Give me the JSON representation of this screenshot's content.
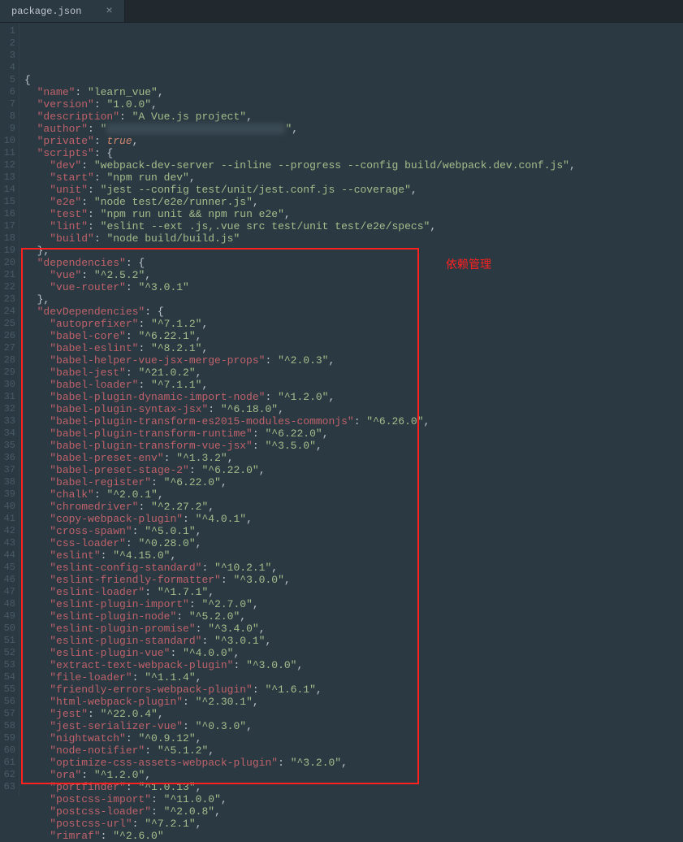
{
  "tab": {
    "title": "package.json",
    "close": "×"
  },
  "annotation": "依赖管理",
  "json": {
    "header": [
      {
        "key": "name",
        "val": "learn_vue"
      },
      {
        "key": "version",
        "val": "1.0.0"
      },
      {
        "key": "description",
        "val": "A Vue.js project"
      }
    ],
    "author_key": "author",
    "private_key": "private",
    "private_val": "true",
    "scripts_key": "scripts",
    "scripts": [
      {
        "key": "dev",
        "val": "webpack-dev-server --inline --progress --config build/webpack.dev.conf.js"
      },
      {
        "key": "start",
        "val": "npm run dev"
      },
      {
        "key": "unit",
        "val": "jest --config test/unit/jest.conf.js --coverage"
      },
      {
        "key": "e2e",
        "val": "node test/e2e/runner.js"
      },
      {
        "key": "test",
        "val": "npm run unit && npm run e2e"
      },
      {
        "key": "lint",
        "val": "eslint --ext .js,.vue src test/unit test/e2e/specs"
      },
      {
        "key": "build",
        "val": "node build/build.js"
      }
    ],
    "dependencies_key": "dependencies",
    "dependencies": [
      {
        "key": "vue",
        "val": "^2.5.2"
      },
      {
        "key": "vue-router",
        "val": "^3.0.1"
      }
    ],
    "devDependencies_key": "devDependencies",
    "devDependencies": [
      {
        "key": "autoprefixer",
        "val": "^7.1.2"
      },
      {
        "key": "babel-core",
        "val": "^6.22.1"
      },
      {
        "key": "babel-eslint",
        "val": "^8.2.1"
      },
      {
        "key": "babel-helper-vue-jsx-merge-props",
        "val": "^2.0.3"
      },
      {
        "key": "babel-jest",
        "val": "^21.0.2"
      },
      {
        "key": "babel-loader",
        "val": "^7.1.1"
      },
      {
        "key": "babel-plugin-dynamic-import-node",
        "val": "^1.2.0"
      },
      {
        "key": "babel-plugin-syntax-jsx",
        "val": "^6.18.0"
      },
      {
        "key": "babel-plugin-transform-es2015-modules-commonjs",
        "val": "^6.26.0"
      },
      {
        "key": "babel-plugin-transform-runtime",
        "val": "^6.22.0"
      },
      {
        "key": "babel-plugin-transform-vue-jsx",
        "val": "^3.5.0"
      },
      {
        "key": "babel-preset-env",
        "val": "^1.3.2"
      },
      {
        "key": "babel-preset-stage-2",
        "val": "^6.22.0"
      },
      {
        "key": "babel-register",
        "val": "^6.22.0"
      },
      {
        "key": "chalk",
        "val": "^2.0.1"
      },
      {
        "key": "chromedriver",
        "val": "^2.27.2"
      },
      {
        "key": "copy-webpack-plugin",
        "val": "^4.0.1"
      },
      {
        "key": "cross-spawn",
        "val": "^5.0.1"
      },
      {
        "key": "css-loader",
        "val": "^0.28.0"
      },
      {
        "key": "eslint",
        "val": "^4.15.0"
      },
      {
        "key": "eslint-config-standard",
        "val": "^10.2.1"
      },
      {
        "key": "eslint-friendly-formatter",
        "val": "^3.0.0"
      },
      {
        "key": "eslint-loader",
        "val": "^1.7.1"
      },
      {
        "key": "eslint-plugin-import",
        "val": "^2.7.0"
      },
      {
        "key": "eslint-plugin-node",
        "val": "^5.2.0"
      },
      {
        "key": "eslint-plugin-promise",
        "val": "^3.4.0"
      },
      {
        "key": "eslint-plugin-standard",
        "val": "^3.0.1"
      },
      {
        "key": "eslint-plugin-vue",
        "val": "^4.0.0"
      },
      {
        "key": "extract-text-webpack-plugin",
        "val": "^3.0.0"
      },
      {
        "key": "file-loader",
        "val": "^1.1.4"
      },
      {
        "key": "friendly-errors-webpack-plugin",
        "val": "^1.6.1"
      },
      {
        "key": "html-webpack-plugin",
        "val": "^2.30.1"
      },
      {
        "key": "jest",
        "val": "^22.0.4"
      },
      {
        "key": "jest-serializer-vue",
        "val": "^0.3.0"
      },
      {
        "key": "nightwatch",
        "val": "^0.9.12"
      },
      {
        "key": "node-notifier",
        "val": "^5.1.2"
      },
      {
        "key": "optimize-css-assets-webpack-plugin",
        "val": "^3.2.0"
      },
      {
        "key": "ora",
        "val": "^1.2.0"
      },
      {
        "key": "portfinder",
        "val": "^1.0.13"
      },
      {
        "key": "postcss-import",
        "val": "^11.0.0"
      },
      {
        "key": "postcss-loader",
        "val": "^2.0.8"
      },
      {
        "key": "postcss-url",
        "val": "^7.2.1"
      },
      {
        "key": "rimraf",
        "val": "^2.6.0"
      }
    ]
  }
}
